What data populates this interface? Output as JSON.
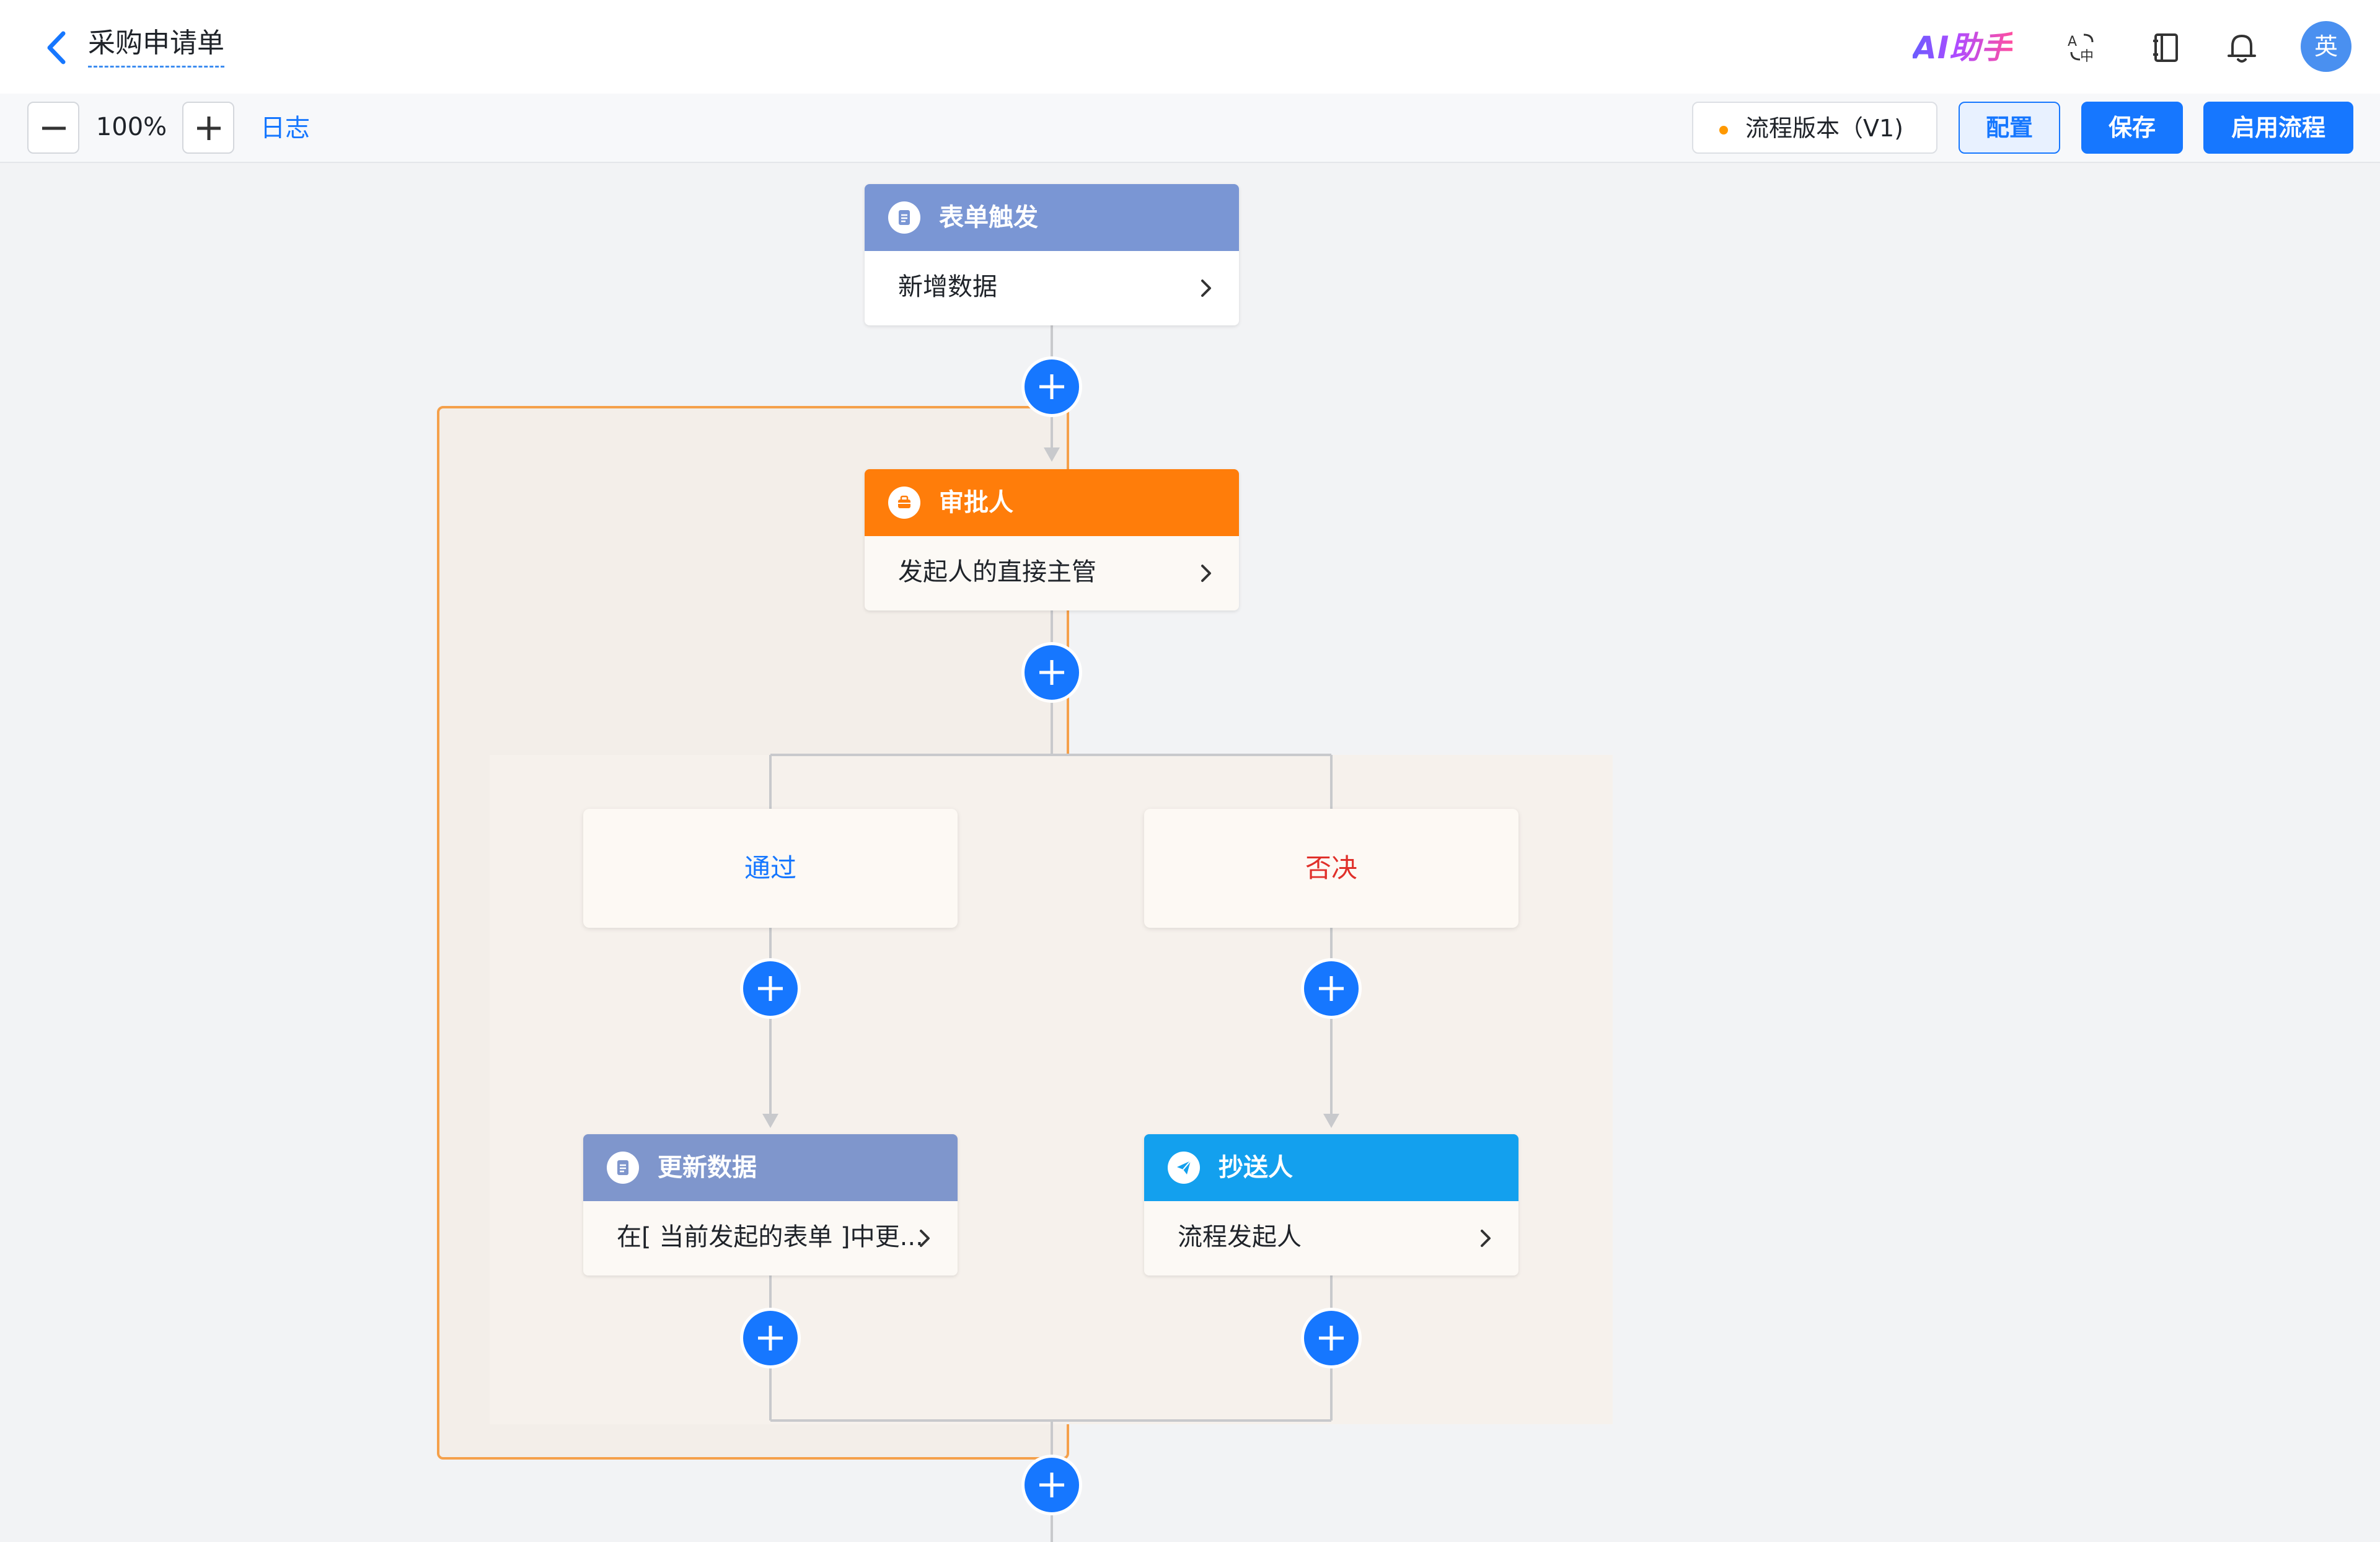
{
  "header": {
    "title": "采购申请单",
    "ai_assistant_label": "AI助手",
    "avatar_text": "英"
  },
  "toolbar": {
    "zoom_value": "100%",
    "log_label": "日志",
    "version_label": "流程版本（V1)",
    "config_label": "配置",
    "save_label": "保存",
    "enable_label": "启用流程"
  },
  "flow": {
    "trigger": {
      "title": "表单触发",
      "subtitle": "新增数据"
    },
    "approver": {
      "title": "审批人",
      "subtitle": "发起人的直接主管"
    },
    "branch_pass": {
      "label": "通过"
    },
    "branch_reject": {
      "label": "否决"
    },
    "update_data": {
      "title": "更新数据",
      "subtitle": "在[ 当前发起的表单 ]中更..."
    },
    "cc": {
      "title": "抄送人",
      "subtitle": "流程发起人"
    }
  },
  "colors": {
    "accent": "#1677ff",
    "trigger_header": "#7a96d4",
    "approver_header": "#ff7d0a",
    "update_header": "#7f96cc",
    "cc_header": "#13a0ee",
    "pass_text": "#1677ff",
    "reject_text": "#e0302a",
    "scope_border": "#f5a04a"
  }
}
